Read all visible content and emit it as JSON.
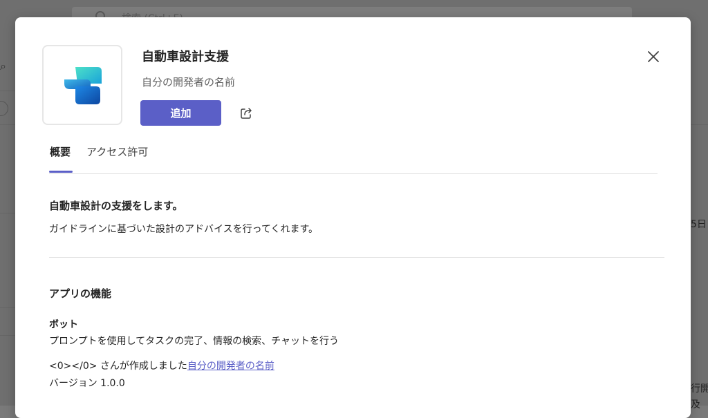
{
  "background": {
    "search_hint": "検索 (Ctrl+E)",
    "right_fragment_1": "5日",
    "right_fragment_2": "行開",
    "right_fragment_3": "及"
  },
  "app": {
    "name": "自動車設計支援",
    "developer": "自分の開発者の名前",
    "icon": "copilot-studio-icon"
  },
  "actions": {
    "add_label": "追加",
    "share_icon": "share-icon",
    "close_icon": "close-icon"
  },
  "tabs": [
    {
      "label": "概要",
      "active": true
    },
    {
      "label": "アクセス許可",
      "active": false
    }
  ],
  "overview": {
    "heading": "自動車設計の支援をします。",
    "body": "ガイドラインに基づいた設計のアドバイスを行ってくれます。",
    "features_heading": "アプリの機能",
    "bot_title": "ボット",
    "bot_desc": "プロンプトを使用してタスクの完了、情報の検索、チャットを行う",
    "created_prefix": "<0></0> さんが作成しました",
    "created_link": "自分の開発者の名前",
    "version": "バージョン 1.0.0"
  },
  "colors": {
    "accent": "#5b5fc7",
    "text": "#242424",
    "muted": "#616161"
  }
}
